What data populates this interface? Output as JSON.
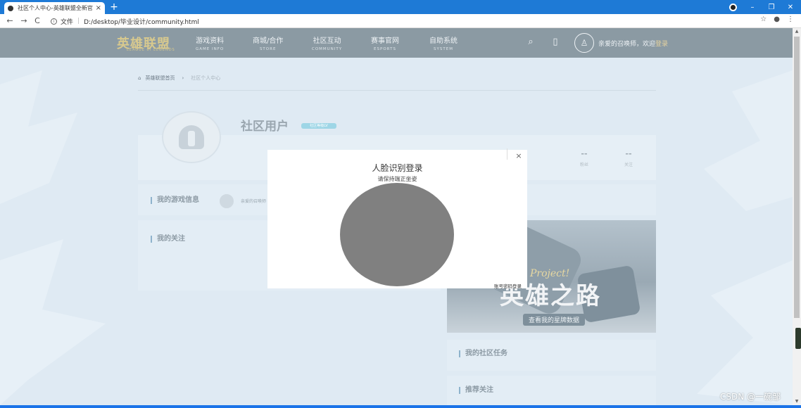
{
  "browser": {
    "tab_title": "社区个人中心-英雄联盟全新官方",
    "tab_close": "×",
    "new_tab": "+",
    "address_label": "文件",
    "url": "D:/desktop/毕业设计/community.html",
    "back": "←",
    "forward": "→",
    "reload": "C",
    "bookmark": "☆",
    "account": "●",
    "menu": "⋮",
    "win_min": "–",
    "win_restore": "❐",
    "win_close": "✕"
  },
  "header": {
    "logo": "英雄联盟",
    "logo_sub": "LEAGUE of LEGENDS",
    "nav": [
      {
        "zh": "游戏资料",
        "en": "GAME INFO"
      },
      {
        "zh": "商城/合作",
        "en": "STORE"
      },
      {
        "zh": "社区互动",
        "en": "COMMUNITY"
      },
      {
        "zh": "赛事官网",
        "en": "ESPORTS"
      },
      {
        "zh": "自助系统",
        "en": "SYSTEM"
      }
    ],
    "search_icon": "⌕",
    "mobile_icon": "▯",
    "avatar_icon": "♙",
    "welcome_prefix": "亲爱的召唤师，欢迎",
    "login_link": "登录"
  },
  "breadcrumb": {
    "home_icon": "⌂",
    "home": "英雄联盟首页",
    "arrow": "›",
    "current": "社区个人中心"
  },
  "profile": {
    "name": "社区用户",
    "badge": "社区等级LV",
    "stats": [
      {
        "num": "--",
        "label": "粉丝"
      },
      {
        "num": "--",
        "label": "关注"
      }
    ]
  },
  "panels": {
    "game_info_title": "我的游戏信息",
    "game_info_text": "亲爱的召唤师",
    "follow_title": "我的关注",
    "tasks_title": "我的社区任务",
    "recommend_title": "推荐关注"
  },
  "banner": {
    "script": "Project!",
    "title": "英雄之路",
    "link": "查看我的星牌数据"
  },
  "modal": {
    "title": "人脸识别登录",
    "hint": "请保持端正坐姿",
    "close": "×",
    "alt_login": "账号密码登录"
  },
  "watermark": "CSDN @一碗邹"
}
